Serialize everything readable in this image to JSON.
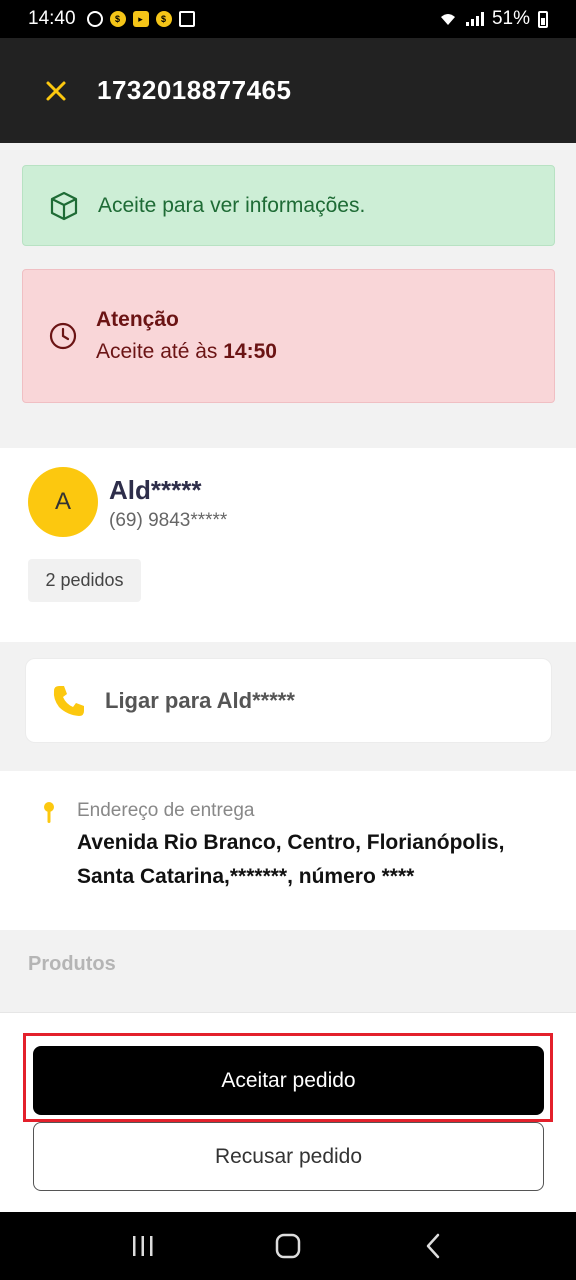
{
  "status_bar": {
    "time": "14:40",
    "battery": "51%"
  },
  "header": {
    "order_id": "1732018877465",
    "close_icon": "close-icon"
  },
  "info_alert": {
    "icon": "box-icon",
    "message": "Aceite para ver informações."
  },
  "warning_alert": {
    "icon": "clock-icon",
    "title": "Atenção",
    "text_prefix": "Aceite até às",
    "deadline": "14:50"
  },
  "customer": {
    "initial": "A",
    "name": "Ald*****",
    "phone": "(69) 9843*****",
    "orders_count": "2 pedidos"
  },
  "call": {
    "icon": "phone-icon",
    "label": "Ligar para Ald*****"
  },
  "address": {
    "icon": "pin-icon",
    "label": "Endereço de entrega",
    "text": "Avenida Rio Branco, Centro, Florianópolis, Santa Catarina,*******, número ****"
  },
  "products": {
    "title": "Produtos"
  },
  "actions": {
    "accept_label": "Aceitar pedido",
    "refuse_label": "Recusar pedido"
  },
  "colors": {
    "accent_yellow": "#fcc80f",
    "header_bg": "#222222",
    "success_bg": "#cdeed6",
    "danger_bg": "#f9d6d8",
    "highlight_red": "#e3202b"
  }
}
